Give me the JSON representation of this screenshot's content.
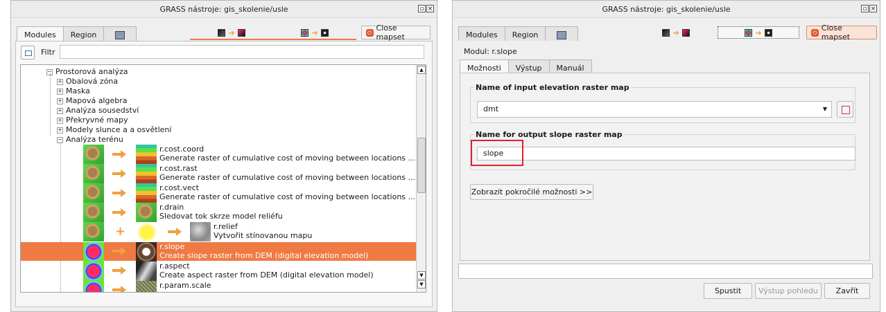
{
  "left": {
    "title": "GRASS nástroje: gis_skolenie/usle",
    "tabs": [
      "Modules",
      "Region"
    ],
    "close_mapset": "Close mapset",
    "filter_label": "Filtr",
    "filter_value": "",
    "tree": {
      "root": "Prostorová analýza",
      "children": [
        "Obalová zóna",
        "Maska",
        "Mapová algebra",
        "Analýza sousedství",
        "Překryvné mapy",
        "Modely slunce a a osvětlení",
        "Analýza terénu"
      ]
    },
    "modules": [
      {
        "name": "r.cost.coord",
        "desc": "Generate raster of cumulative cost of moving between locations ..."
      },
      {
        "name": "r.cost.rast",
        "desc": "Generate raster of cumulative cost of moving between locations ..."
      },
      {
        "name": "r.cost.vect",
        "desc": "Generate raster of cumulative cost of moving between locations ..."
      },
      {
        "name": "r.drain",
        "desc": "Sledovat tok skrze model reliéfu"
      },
      {
        "name": "r.relief",
        "desc": "Vytvořit stínovanou mapu"
      },
      {
        "name": "r.slope",
        "desc": "Create slope raster from DEM (digital elevation model)"
      },
      {
        "name": "r.aspect",
        "desc": "Create aspect raster from DEM (digital elevation model)"
      },
      {
        "name": "r.param.scale",
        "desc": ""
      }
    ]
  },
  "right": {
    "title": "GRASS nástroje: gis_skolenie/usle",
    "tabs": [
      "Modules",
      "Region"
    ],
    "close_mapset": "Close mapset",
    "module_label": "Modul: r.slope",
    "subtabs": [
      "Možnosti",
      "Výstup",
      "Manuál"
    ],
    "input_label": "Name of input elevation raster map",
    "input_value": "dmt",
    "output_label": "Name for output slope raster map",
    "output_value": "slope",
    "advanced_button": "Zobrazit pokročilé možnosti >>",
    "status_value": "",
    "buttons": {
      "run": "Spustit",
      "view_output": "Výstup pohledu",
      "close": "Zavřít"
    }
  },
  "colors": {
    "selection": "#ef7a44",
    "highlight_box": "#e0202a",
    "close_icon": "#e0542c"
  }
}
